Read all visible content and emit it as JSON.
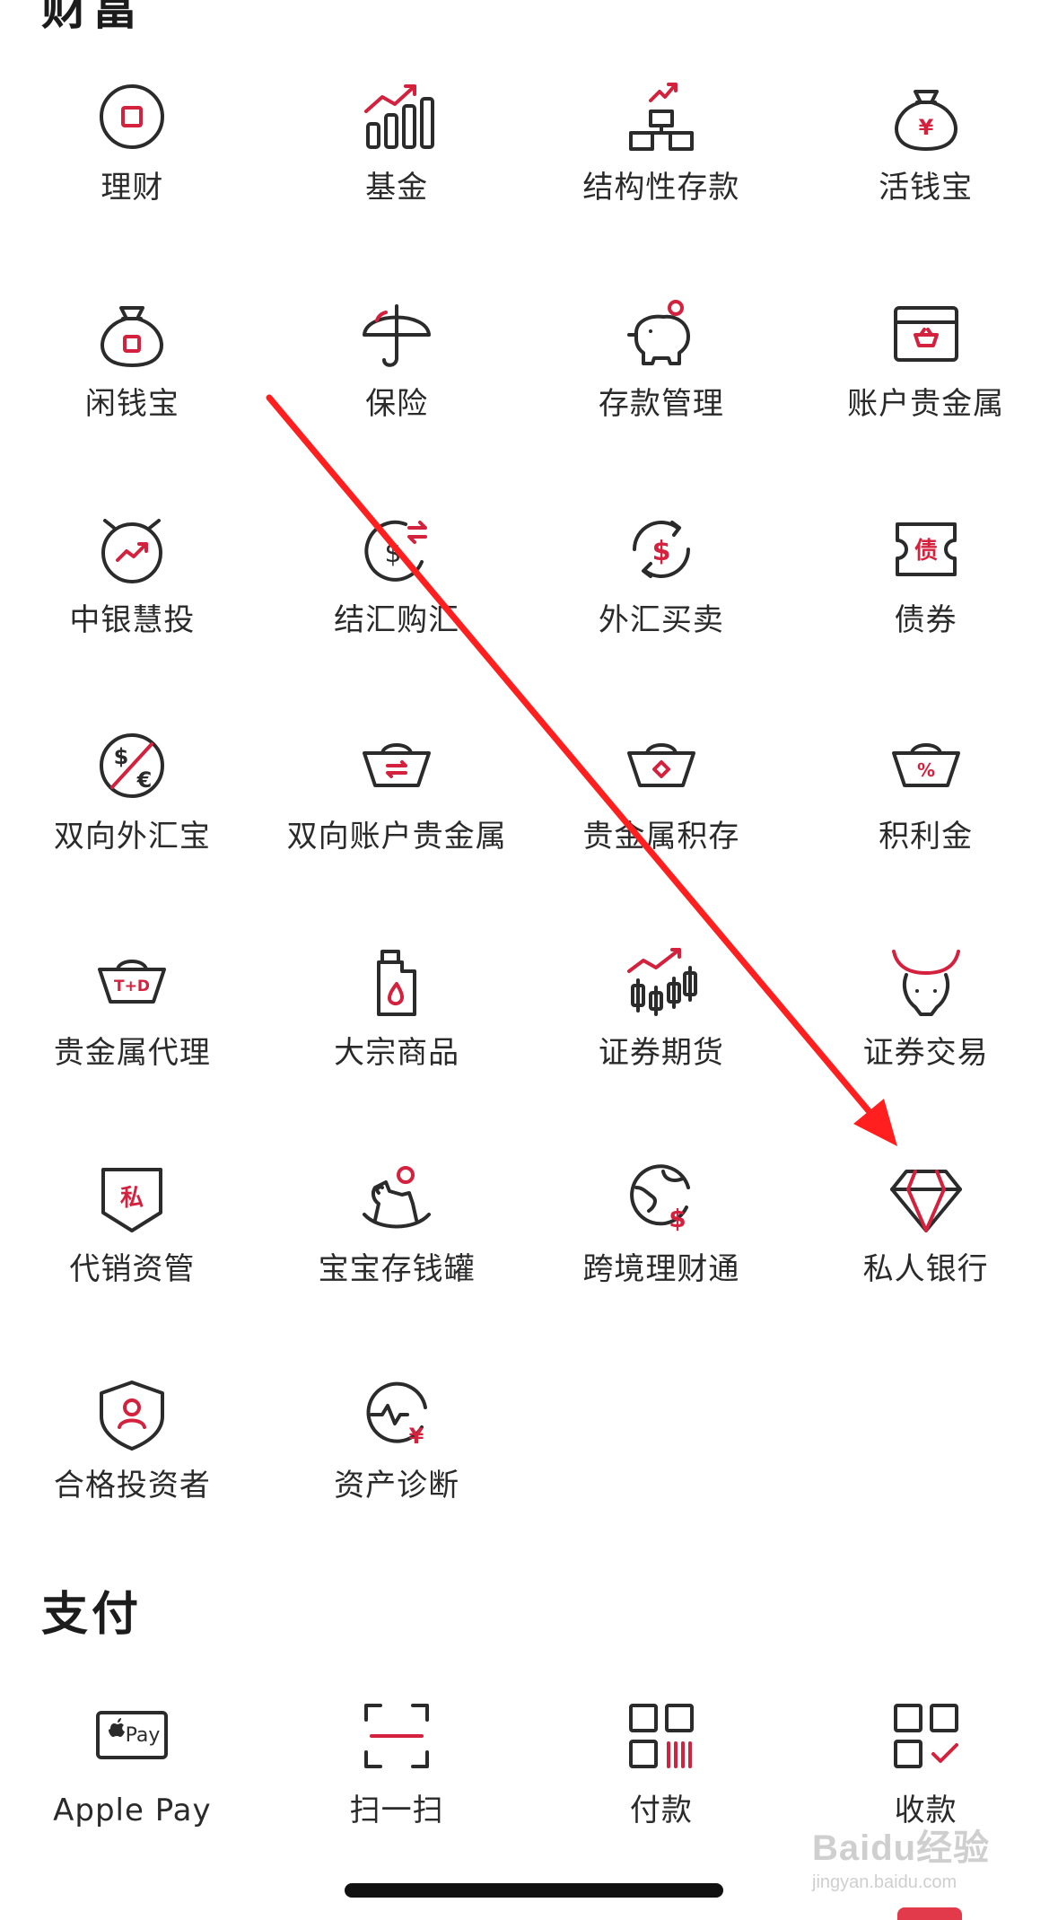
{
  "sections": {
    "wealth": {
      "title": "财富"
    },
    "payment": {
      "title": "支付"
    }
  },
  "wealth_items": [
    {
      "label": "理财",
      "icon": "wealth-management-icon"
    },
    {
      "label": "基金",
      "icon": "fund-chart-icon"
    },
    {
      "label": "结构性存款",
      "icon": "structured-deposit-icon"
    },
    {
      "label": "活钱宝",
      "icon": "yen-money-bag-icon"
    },
    {
      "label": "闲钱宝",
      "icon": "money-bag-icon"
    },
    {
      "label": "保险",
      "icon": "umbrella-icon"
    },
    {
      "label": "存款管理",
      "icon": "piggy-bank-icon"
    },
    {
      "label": "账户贵金属",
      "icon": "gold-box-icon"
    },
    {
      "label": "中银慧投",
      "icon": "smart-invest-icon"
    },
    {
      "label": "结汇购汇",
      "icon": "currency-exchange-icon"
    },
    {
      "label": "外汇买卖",
      "icon": "forex-trade-icon"
    },
    {
      "label": "债券",
      "icon": "bond-ticket-icon"
    },
    {
      "label": "双向外汇宝",
      "icon": "dollar-euro-icon"
    },
    {
      "label": "双向账户贵金属",
      "icon": "ingot-exchange-icon"
    },
    {
      "label": "贵金属积存",
      "icon": "ingot-diamond-icon"
    },
    {
      "label": "积利金",
      "icon": "ingot-percent-icon"
    },
    {
      "label": "贵金属代理",
      "icon": "ingot-td-icon"
    },
    {
      "label": "大宗商品",
      "icon": "oil-can-icon"
    },
    {
      "label": "证券期货",
      "icon": "candlestick-icon"
    },
    {
      "label": "证券交易",
      "icon": "bull-icon"
    },
    {
      "label": "代销资管",
      "icon": "private-shield-icon"
    },
    {
      "label": "宝宝存钱罐",
      "icon": "rocking-horse-icon"
    },
    {
      "label": "跨境理财通",
      "icon": "globe-dollar-icon"
    },
    {
      "label": "私人银行",
      "icon": "diamond-icon"
    },
    {
      "label": "合格投资者",
      "icon": "user-shield-icon"
    },
    {
      "label": "资产诊断",
      "icon": "asset-diagnosis-icon"
    }
  ],
  "payment_items": [
    {
      "label": "Apple Pay",
      "icon": "apple-pay-icon",
      "badge_text": "Pay"
    },
    {
      "label": "扫一扫",
      "icon": "scan-icon"
    },
    {
      "label": "付款",
      "icon": "pay-code-icon"
    },
    {
      "label": "收款",
      "icon": "receive-code-icon"
    }
  ],
  "watermark": {
    "main": "Baidu经验",
    "sub": "jingyan.baidu.com"
  },
  "colors": {
    "accent": "#d4213d",
    "icon_stroke": "#2b2b2b",
    "annotation_arrow": "#ff1f1f"
  }
}
